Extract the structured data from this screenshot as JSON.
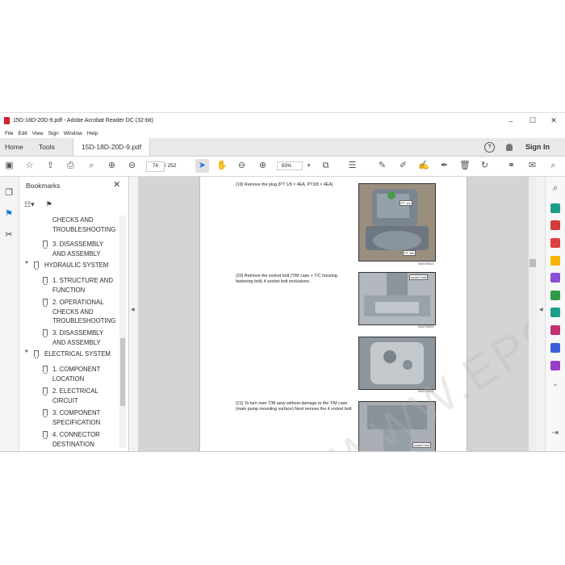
{
  "window": {
    "title": "15D-18D-20D-9.pdf - Adobe Acrobat Reader DC (32-bit)",
    "controls": [
      "–",
      "☐",
      "✕"
    ]
  },
  "menu": [
    "File",
    "Edit",
    "View",
    "Sign",
    "Window",
    "Help"
  ],
  "tabs": {
    "home": "Home",
    "tools": "Tools",
    "document": "15D-18D-20D-9.pdf"
  },
  "header_right": {
    "help": "?",
    "signin": "Sign In"
  },
  "toolbar": {
    "page_current": "74",
    "page_total": "/ 252",
    "zoom": "63%",
    "icons": [
      "save-icon",
      "bookmark-star-icon",
      "cloud-upload-icon",
      "print-icon",
      "zoom-search-icon",
      "page-up-icon",
      "page-down-icon",
      "select-arrow-icon",
      "hand-icon",
      "zoom-out-icon",
      "zoom-in-icon",
      "zoom-dropdown-icon",
      "fit-page-icon",
      "scroll-mode-icon",
      "comment-icon",
      "highlight-icon",
      "draw-icon",
      "fill-sign-icon",
      "delete-icon",
      "rotate-icon",
      "link-icon",
      "mail-icon",
      "search-icon"
    ]
  },
  "bookmarks": {
    "title": "Bookmarks",
    "items": [
      {
        "level": 2,
        "text": "CHECKS AND TROUBLESHOOTING",
        "icon": false
      },
      {
        "level": 2,
        "text": "3. DISASSEMBLY AND ASSEMBLY",
        "icon": true
      },
      {
        "level": 1,
        "text": "HYDRAULIC SYSTEM",
        "icon": true
      },
      {
        "level": 2,
        "text": "1. STRUCTURE AND FUNCTION",
        "icon": true
      },
      {
        "level": 2,
        "text": "2. OPERATIONAL CHECKS AND TROUBLESHOOTING",
        "icon": true
      },
      {
        "level": 2,
        "text": "3. DISASSEMBLY AND ASSEMBLY",
        "icon": true
      },
      {
        "level": 1,
        "text": "ELECTRICAL SYSTEM",
        "icon": true
      },
      {
        "level": 2,
        "text": "1. COMPONENT LOCATION",
        "icon": true
      },
      {
        "level": 2,
        "text": "2. ELECTRICAL CIRCUIT",
        "icon": true
      },
      {
        "level": 2,
        "text": "3. COMPONENT SPECIFICATION",
        "icon": true
      },
      {
        "level": 2,
        "text": "4. CONNECTOR DESTINATION",
        "icon": true
      }
    ]
  },
  "document": {
    "watermark": "WWW.EPCDEPO.COM",
    "steps": [
      {
        "text": "(19) Remove the plug.(PT 1/8 × 4EA, PT3/8 × 4EA)"
      },
      {
        "text": "(20) Remove the socket bolt (T/M case + T/C housing fastening bolt) 4 socket bolt exclusions."
      },
      {
        "text": "(21) To turn over T/M assy without damage to the T/M case. (main pump mounting surface) Next remove the 4 socket bolt."
      }
    ],
    "photo_tags": [
      "PT 1/8",
      "PT 3/8",
      "socket bolt",
      "socket bolt"
    ],
    "figure_ids": [
      "50D9TM024",
      "50D9TM025",
      "50D9TM026"
    ]
  }
}
